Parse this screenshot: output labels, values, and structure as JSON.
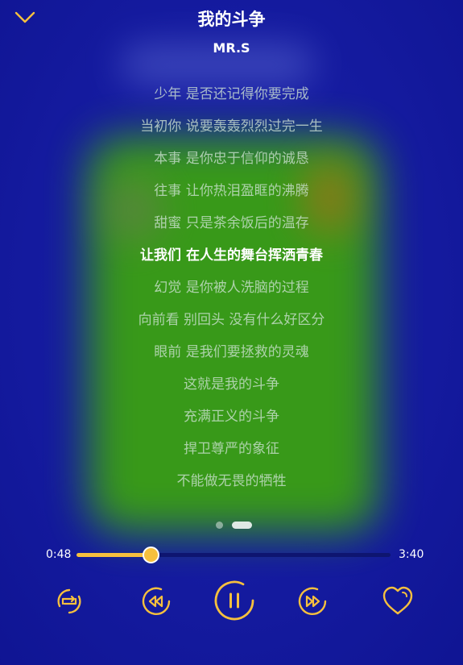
{
  "colors": {
    "accent": "#f6c03e",
    "background": "#13169e",
    "cover_tint": "#3aa012",
    "lyric_inactive": "#cde1d2",
    "lyric_active": "#ffffff"
  },
  "header": {
    "collapse_icon": "chevron-down-icon",
    "title": "我的斗争",
    "artist": "MR.S"
  },
  "lyrics": {
    "active_index": 5,
    "lines": [
      "少年 是否还记得你要完成",
      "当初你 说要轰轰烈烈过完一生",
      "本事 是你忠于信仰的诚恳",
      "往事 让你热泪盈眶的沸腾",
      "甜蜜 只是茶余饭后的温存",
      "让我们 在人生的舞台挥洒青春",
      "幻觉 是你被人洗脑的过程",
      "向前看 别回头 没有什么好区分",
      "眼前 是我们要拯救的灵魂",
      "这就是我的斗争",
      "充满正义的斗争",
      "捍卫尊严的象征",
      "不能做无畏的牺牲"
    ]
  },
  "pager": {
    "pages": 2,
    "current": 2
  },
  "player": {
    "current_time": "0:48",
    "total_time": "3:40",
    "progress_fraction": 0.235
  },
  "controls": {
    "repeat": "repeat-icon",
    "previous": "rewind-icon",
    "play_pause": "pause-icon",
    "next": "fast-forward-icon",
    "favorite": "heart-icon"
  }
}
